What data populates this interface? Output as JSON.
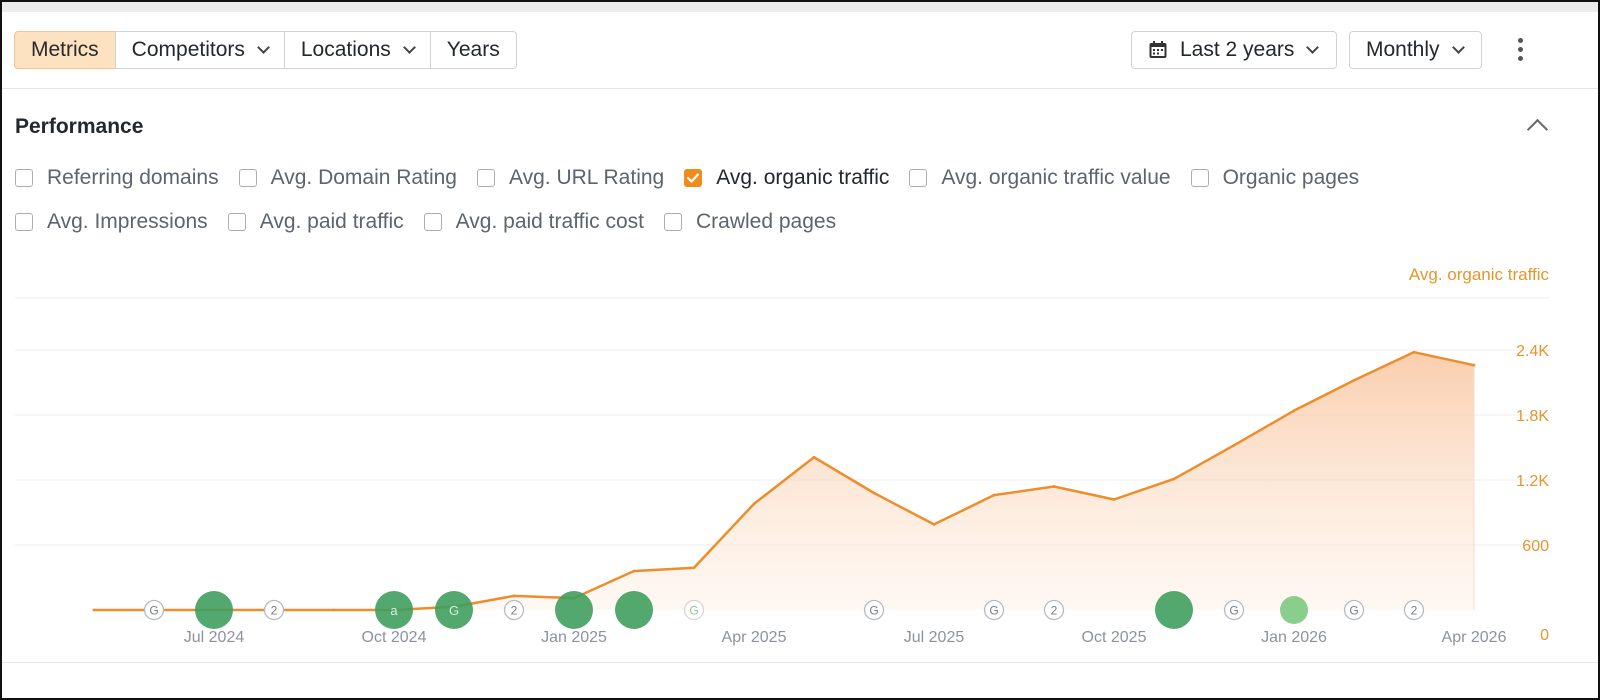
{
  "toolbar": {
    "tabs": [
      {
        "label": "Metrics",
        "active": true
      },
      {
        "label": "Competitors",
        "dropdown": true
      },
      {
        "label": "Locations",
        "dropdown": true
      },
      {
        "label": "Years",
        "dropdown": false
      }
    ],
    "date_range": {
      "label": "Last 2 years",
      "icon": "calendar-icon"
    },
    "granularity": {
      "label": "Monthly"
    },
    "more_icon": "kebab-icon"
  },
  "section": {
    "title": "Performance",
    "collapse_icon": "chevron-up-icon"
  },
  "metrics": {
    "row1": [
      {
        "label": "Referring domains",
        "checked": false
      },
      {
        "label": "Avg. Domain Rating",
        "checked": false
      },
      {
        "label": "Avg. URL Rating",
        "checked": false
      },
      {
        "label": "Avg. organic traffic",
        "checked": true
      },
      {
        "label": "Avg. organic traffic value",
        "checked": false
      },
      {
        "label": "Organic pages",
        "checked": false
      }
    ],
    "row2": [
      {
        "label": "Avg. Impressions",
        "checked": false
      },
      {
        "label": "Avg. paid traffic",
        "checked": false
      },
      {
        "label": "Avg. paid traffic cost",
        "checked": false
      },
      {
        "label": "Crawled pages",
        "checked": false
      }
    ]
  },
  "colors": {
    "accent": "#f08b1d",
    "line": "#ec8e2c",
    "axis_text": "#e5962e",
    "marker_dark": "#3f9f5e",
    "marker_light": "#7dc97f"
  },
  "chart_data": {
    "type": "area",
    "series_label": "Avg. organic traffic",
    "x": [
      "2024-05",
      "2024-06",
      "2024-07",
      "2024-08",
      "2024-09",
      "2024-10",
      "2024-11",
      "2024-12",
      "2025-01",
      "2025-02",
      "2025-03",
      "2025-04",
      "2025-05",
      "2025-06",
      "2025-07",
      "2025-08",
      "2025-09",
      "2025-10",
      "2025-11",
      "2025-12",
      "2026-01",
      "2026-02",
      "2026-03",
      "2026-04"
    ],
    "values": [
      0,
      0,
      0,
      0,
      0,
      0,
      30,
      130,
      110,
      360,
      390,
      980,
      1410,
      1080,
      790,
      1060,
      1140,
      1020,
      1210,
      1520,
      1840,
      2120,
      2380,
      2260
    ],
    "x_tick_labels": [
      "Jul 2024",
      "Oct 2024",
      "Jan 2025",
      "Apr 2025",
      "Jul 2025",
      "Oct 2025",
      "Jan 2026",
      "Apr 2026"
    ],
    "y_ticks": [
      0,
      600,
      1200,
      1800,
      2400
    ],
    "y_tick_labels": [
      "0",
      "600",
      "1.2K",
      "1.8K",
      "2.4K"
    ],
    "ylim": [
      0,
      2400
    ],
    "grid": true,
    "annotations": [
      {
        "x": "2024-06",
        "type": "badge",
        "text": "G"
      },
      {
        "x": "2024-07",
        "type": "dot",
        "size": "large",
        "shade": "dark"
      },
      {
        "x": "2024-08",
        "type": "badge",
        "text": "2"
      },
      {
        "x": "2024-10",
        "type": "dot",
        "size": "large",
        "shade": "dark",
        "text": "a"
      },
      {
        "x": "2024-11",
        "type": "dot",
        "size": "large",
        "shade": "dark",
        "text": "G"
      },
      {
        "x": "2024-12",
        "type": "badge",
        "text": "2"
      },
      {
        "x": "2025-01",
        "type": "dot",
        "size": "large",
        "shade": "dark"
      },
      {
        "x": "2025-02",
        "type": "dot",
        "size": "large",
        "shade": "dark"
      },
      {
        "x": "2025-03",
        "type": "badge",
        "text": "G",
        "faded": true
      },
      {
        "x": "2025-06",
        "type": "badge",
        "text": "G"
      },
      {
        "x": "2025-08",
        "type": "badge",
        "text": "G"
      },
      {
        "x": "2025-09",
        "type": "badge",
        "text": "2"
      },
      {
        "x": "2025-11",
        "type": "dot",
        "size": "large",
        "shade": "dark"
      },
      {
        "x": "2025-12",
        "type": "badge",
        "text": "G"
      },
      {
        "x": "2026-01",
        "type": "dot",
        "size": "small",
        "shade": "light"
      },
      {
        "x": "2026-02",
        "type": "badge",
        "text": "G"
      },
      {
        "x": "2026-03",
        "type": "badge",
        "text": "2"
      }
    ]
  }
}
